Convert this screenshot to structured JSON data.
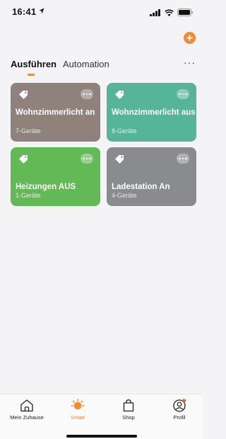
{
  "status_bar": {
    "time": "16:41"
  },
  "tabs": {
    "active": "Ausführen",
    "inactive": "Automation"
  },
  "scenes": [
    {
      "title": "Wohnzimmerlicht an",
      "subtitle": "7-Geräte"
    },
    {
      "title": "Wohnzimmerlicht aus",
      "subtitle": "8-Geräte"
    },
    {
      "title": "Heizungen AUS",
      "subtitle": "1-Geräte"
    },
    {
      "title": "Ladestation An",
      "subtitle": "4-Geräte"
    }
  ],
  "colors": {
    "accent": "#f7892e",
    "card_brown": "#8f817b",
    "card_teal": "#56b497",
    "card_green": "#63b955",
    "card_gray": "#8a8b8c"
  },
  "bottom_nav": [
    {
      "label": "Mein Zuhause",
      "icon": "home-icon"
    },
    {
      "label": "Smart",
      "icon": "sun-icon"
    },
    {
      "label": "Shop",
      "icon": "bag-icon"
    },
    {
      "label": "Profil",
      "icon": "profile-icon"
    }
  ]
}
